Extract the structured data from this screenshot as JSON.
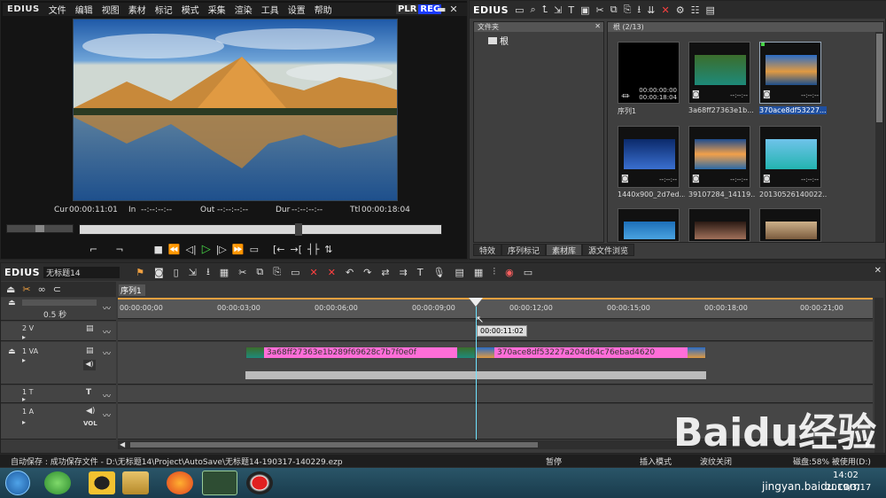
{
  "player": {
    "logo": "EDIUS",
    "menu": [
      "文件",
      "编辑",
      "视图",
      "素材",
      "标记",
      "模式",
      "采集",
      "渲染",
      "工具",
      "设置",
      "帮助"
    ],
    "plr": "PLR",
    "rec": "REC",
    "timecodes": {
      "cur_label": "Cur",
      "cur": "00:00:11:01",
      "in_label": "In",
      "in": "--:--:--:--",
      "out_label": "Out",
      "out": "--:--:--:--",
      "dur_label": "Dur",
      "dur": "--:--:--:--",
      "ttl_label": "Ttl",
      "ttl": "00:00:18:04"
    }
  },
  "bin": {
    "logo": "EDIUS",
    "folder_header": "文件夹",
    "root_folder": "根",
    "content_header": "根 (2/13)",
    "tabs": [
      "特效",
      "序列标记",
      "素材库",
      "源文件浏览"
    ],
    "items": [
      {
        "label": "序列1",
        "tc1": "00:00:00:00",
        "tc2": "00:00:18:04",
        "type": "sequence"
      },
      {
        "label": "3a68ff27363e1b...",
        "tc1": "--:--:--",
        "tc2": "",
        "type": "image"
      },
      {
        "label": "370ace8df53227...",
        "tc1": "--:--:--",
        "tc2": "",
        "type": "image",
        "selected": true
      },
      {
        "label": "1440x900_2d7ed...",
        "tc1": "--:--:--",
        "tc2": "",
        "type": "image"
      },
      {
        "label": "39107284_14119...",
        "tc1": "--:--:--",
        "tc2": "",
        "type": "image"
      },
      {
        "label": "20130526140022...",
        "tc1": "--:--:--",
        "tc2": "",
        "type": "image"
      }
    ]
  },
  "timeline": {
    "logo": "EDIUS",
    "project": "无标题14",
    "sequence_tab": "序列1",
    "scale": "0.5 秒",
    "ruler": [
      "00:00:00;00",
      "00:00:03;00",
      "00:00:06;00",
      "00:00:09;00",
      "00:00:12;00",
      "00:00:15;00",
      "00:00:18;00",
      "00:00:21;00"
    ],
    "cursor_tc": "00:00:11:02",
    "tracks": [
      {
        "name": "2 V"
      },
      {
        "name": "1 VA"
      },
      {
        "name": "1 T"
      },
      {
        "name": "1 A",
        "vol": "VOL"
      }
    ],
    "clips": [
      {
        "label": "3a68ff27363e1b289f69628c7b7f0e0f"
      },
      {
        "label": "370ace8df53227a204d64c76ebad4620"
      }
    ]
  },
  "status": {
    "autosave": "自动保存 : 成功保存文件 - D:\\无标题14\\Project\\AutoSave\\无标题14-190317-140229.ezp",
    "pause": "暂停",
    "insert_mode": "插入模式",
    "ripple": "波纹关闭",
    "disk": "磁盘:58% 被使用(D:)"
  },
  "taskbar": {
    "time": "14:02",
    "date": "2019/3/17",
    "watermark": "jingyan.baidu.com",
    "watermark_logo": "Baidu经验"
  },
  "colors": {
    "clip_pink": "#ff6ed8",
    "rec_blue": "#1a3aff",
    "play_green": "#47d447",
    "cursor_cyan": "#6fe3ff"
  }
}
